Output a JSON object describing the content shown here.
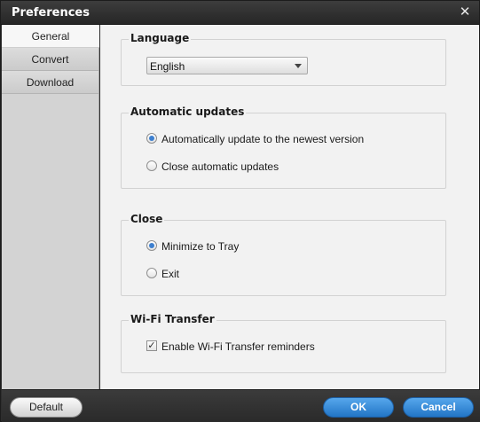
{
  "window": {
    "title": "Preferences",
    "close_icon": "close-icon",
    "close_glyph": "✕"
  },
  "sidebar": {
    "items": [
      {
        "label": "General",
        "active": true
      },
      {
        "label": "Convert",
        "active": false
      },
      {
        "label": "Download",
        "active": false
      }
    ]
  },
  "language": {
    "title": "Language",
    "selected": "English"
  },
  "updates": {
    "title": "Automatic updates",
    "options": [
      {
        "label": "Automatically update to the newest version",
        "checked": true
      },
      {
        "label": "Close automatic updates",
        "checked": false
      }
    ]
  },
  "close": {
    "title": "Close",
    "options": [
      {
        "label": "Minimize to Tray",
        "checked": true
      },
      {
        "label": "Exit",
        "checked": false
      }
    ]
  },
  "wifi": {
    "title": "Wi-Fi Transfer",
    "reminder_label": "Enable Wi-Fi Transfer reminders",
    "reminder_checked": true,
    "check_glyph": "✓"
  },
  "footer": {
    "default_label": "Default",
    "ok_label": "OK",
    "cancel_label": "Cancel"
  },
  "colors": {
    "accent": "#3c7fcf",
    "button_blue": "#2275c6",
    "titlebar": "#2e2e2e",
    "panel": "#f2f2f2"
  }
}
